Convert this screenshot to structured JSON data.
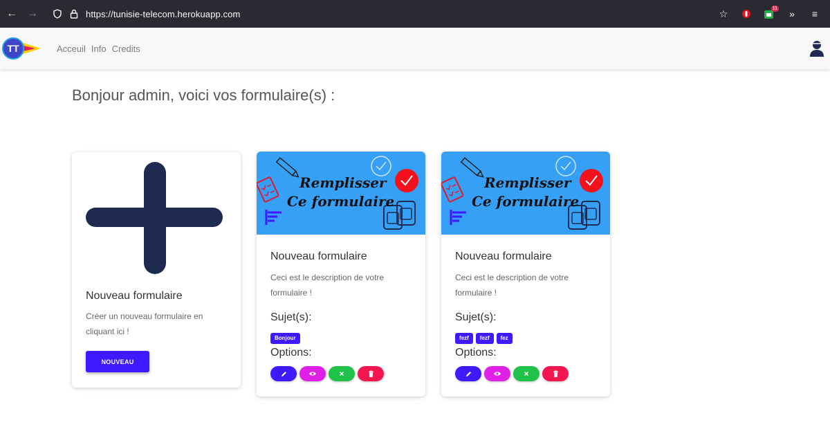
{
  "browser": {
    "url": "https://tunisie-telecom.herokuapp.com",
    "extension_badge": "11"
  },
  "navbar": {
    "links": [
      "Acceuil",
      "Info",
      "Credits"
    ]
  },
  "page": {
    "title": "Bonjour admin, voici vos formulaire(s) :"
  },
  "new_card": {
    "title": "Nouveau formulaire",
    "description": "Créer un nouveau formulaire en cliquant ici !",
    "button_label": "NOUVEAU"
  },
  "forms": [
    {
      "banner_line1": "Remplisser",
      "banner_line2": "Ce formulaire",
      "title": "Nouveau formulaire",
      "description": "Ceci est le description de votre formulaire !",
      "subjects_label": "Sujet(s):",
      "subjects": [
        "Bonjour"
      ],
      "options_label": "Options:"
    },
    {
      "banner_line1": "Remplisser",
      "banner_line2": "Ce formulaire",
      "title": "Nouveau formulaire",
      "description": "Ceci est le description de votre formulaire !",
      "subjects_label": "Sujet(s):",
      "subjects": [
        "fezf",
        "fezf",
        "fez"
      ],
      "options_label": "Options:"
    }
  ],
  "option_buttons": [
    {
      "icon": "pencil-icon",
      "color": "#3f19ff"
    },
    {
      "icon": "eye-icon",
      "color": "#e020e8"
    },
    {
      "icon": "close-icon",
      "color": "#21c24a"
    },
    {
      "icon": "trash-icon",
      "color": "#f5164f"
    }
  ],
  "colors": {
    "primary": "#3f19ff",
    "navy": "#1e2a50",
    "banner_blue": "#36a0f6",
    "check_red": "#f5111c"
  }
}
